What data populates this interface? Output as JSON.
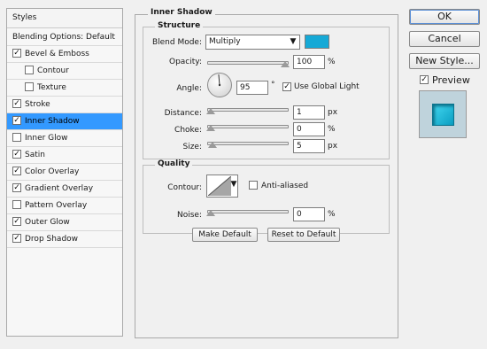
{
  "styles_panel": {
    "header": "Styles",
    "blending_options": "Blending Options: Default",
    "items": [
      {
        "label": "Bevel & Emboss",
        "checked": true,
        "indent": false,
        "selected": false
      },
      {
        "label": "Contour",
        "checked": false,
        "indent": true,
        "selected": false
      },
      {
        "label": "Texture",
        "checked": false,
        "indent": true,
        "selected": false
      },
      {
        "label": "Stroke",
        "checked": true,
        "indent": false,
        "selected": false
      },
      {
        "label": "Inner Shadow",
        "checked": true,
        "indent": false,
        "selected": true
      },
      {
        "label": "Inner Glow",
        "checked": false,
        "indent": false,
        "selected": false
      },
      {
        "label": "Satin",
        "checked": true,
        "indent": false,
        "selected": false
      },
      {
        "label": "Color Overlay",
        "checked": true,
        "indent": false,
        "selected": false
      },
      {
        "label": "Gradient Overlay",
        "checked": true,
        "indent": false,
        "selected": false
      },
      {
        "label": "Pattern Overlay",
        "checked": false,
        "indent": false,
        "selected": false
      },
      {
        "label": "Outer Glow",
        "checked": true,
        "indent": false,
        "selected": false
      },
      {
        "label": "Drop Shadow",
        "checked": true,
        "indent": false,
        "selected": false
      }
    ]
  },
  "inner_shadow": {
    "title": "Inner Shadow",
    "structure": {
      "title": "Structure",
      "blend_mode_label": "Blend Mode:",
      "blend_mode_value": "Multiply",
      "shadow_color": "#16a9d6",
      "opacity_label": "Opacity:",
      "opacity_value": "100",
      "opacity_unit": "%",
      "angle_label": "Angle:",
      "angle_value": "95",
      "angle_unit": "°",
      "use_global_light_label": "Use Global Light",
      "use_global_light_checked": true,
      "distance_label": "Distance:",
      "distance_value": "1",
      "distance_unit": "px",
      "choke_label": "Choke:",
      "choke_value": "0",
      "choke_unit": "%",
      "size_label": "Size:",
      "size_value": "5",
      "size_unit": "px"
    },
    "quality": {
      "title": "Quality",
      "contour_label": "Contour:",
      "anti_aliased_label": "Anti-aliased",
      "anti_aliased_checked": false,
      "noise_label": "Noise:",
      "noise_value": "0",
      "noise_unit": "%"
    },
    "make_default_label": "Make Default",
    "reset_to_default_label": "Reset to Default"
  },
  "actions": {
    "ok_label": "OK",
    "cancel_label": "Cancel",
    "new_style_label": "New Style...",
    "preview_label": "Preview",
    "preview_checked": true
  }
}
